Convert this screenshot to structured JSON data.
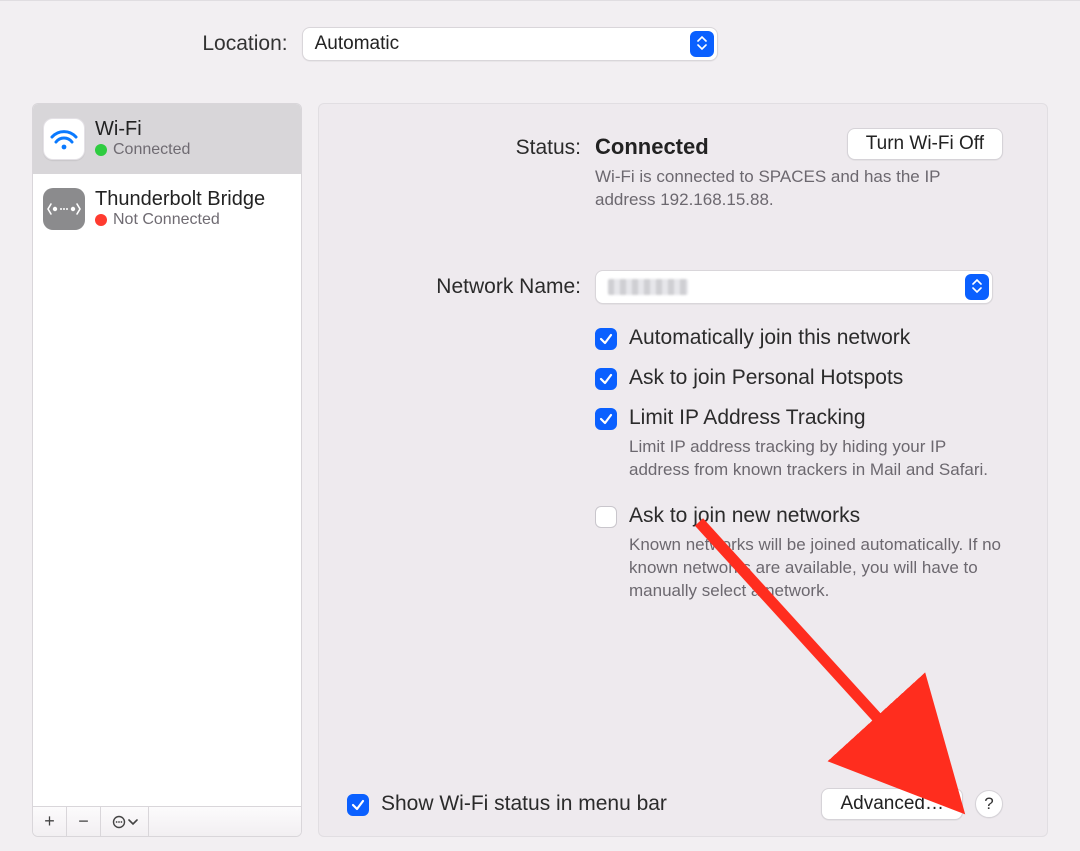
{
  "location": {
    "label": "Location:",
    "value": "Automatic"
  },
  "sidebar": {
    "items": [
      {
        "name": "Wi-Fi",
        "status": "Connected",
        "dot": "green",
        "icon": "wifi"
      },
      {
        "name": "Thunderbolt Bridge",
        "status": "Not Connected",
        "dot": "red",
        "icon": "tb"
      }
    ],
    "toolbar": {
      "add": "+",
      "remove": "−",
      "more": "⊙"
    }
  },
  "status": {
    "label": "Status:",
    "value": "Connected",
    "desc": "Wi-Fi is connected to SPACES and has the IP address 192.168.15.88.",
    "turn_off": "Turn Wi-Fi Off"
  },
  "network_name": {
    "label": "Network Name:"
  },
  "checks": {
    "auto_join": {
      "label": "Automatically join this network",
      "checked": true
    },
    "hotspots": {
      "label": "Ask to join Personal Hotspots",
      "checked": true
    },
    "limit_ip": {
      "label": "Limit IP Address Tracking",
      "desc": "Limit IP address tracking by hiding your IP address from known trackers in Mail and Safari.",
      "checked": true
    },
    "ask_new": {
      "label": "Ask to join new networks",
      "desc": "Known networks will be joined automatically. If no known networks are available, you will have to manually select a network.",
      "checked": false
    }
  },
  "bottom": {
    "show_menu": {
      "label": "Show Wi-Fi status in menu bar",
      "checked": true
    },
    "advanced": "Advanced…",
    "help": "?"
  }
}
